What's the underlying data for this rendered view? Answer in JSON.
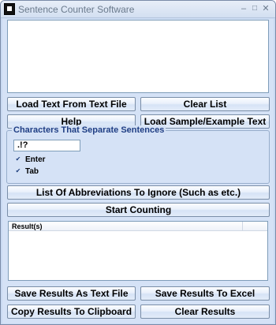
{
  "window": {
    "title": "Sentence Counter Software",
    "min_glyph": "–",
    "max_glyph": "□",
    "close_glyph": "✕"
  },
  "buttons": {
    "load_text": "Load Text From Text File",
    "clear_list": "Clear List",
    "help": "Help",
    "load_sample": "Load Sample/Example Text",
    "abbreviations": "List Of Abbreviations To Ignore (Such as etc.)",
    "start_counting": "Start Counting",
    "save_text": "Save Results As Text File",
    "save_excel": "Save Results To Excel",
    "copy_clipboard": "Copy Results To Clipboard",
    "clear_results": "Clear Results"
  },
  "separators": {
    "legend": "Characters That Separate Sentences",
    "value": ".!?",
    "enter_label": "Enter",
    "enter_checked": true,
    "tab_label": "Tab",
    "tab_checked": true,
    "check_glyph": "✔"
  },
  "results": {
    "column_header": "Result(s)"
  }
}
